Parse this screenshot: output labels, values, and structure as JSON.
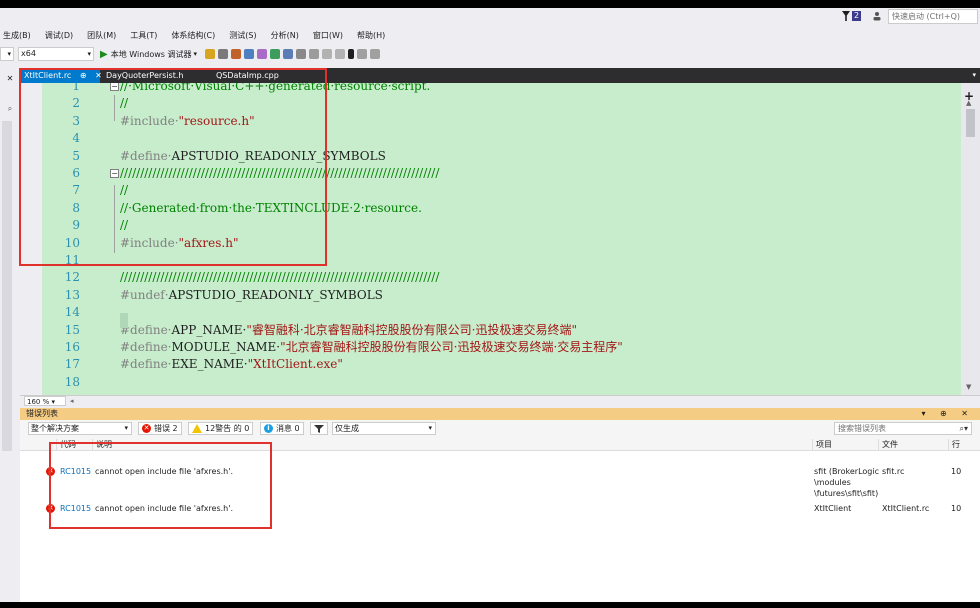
{
  "quick_launch": {
    "placeholder": "快速启动 (Ctrl+Q)",
    "notification_count": "2"
  },
  "menu": [
    "生成(B)",
    "调试(D)",
    "团队(M)",
    "工具(T)",
    "体系结构(C)",
    "测试(S)",
    "分析(N)",
    "窗口(W)",
    "帮助(H)"
  ],
  "toolbar": {
    "platform": "x64",
    "run_label": "本地 Windows 调试器"
  },
  "tabs": [
    {
      "label": "XtItClient.rc",
      "pin": "⊕",
      "close": "✕"
    },
    {
      "label": "DayQuoterPersist.h"
    },
    {
      "label": "QSDataImp.cpp"
    }
  ],
  "editor": {
    "lines": [
      {
        "n": "1",
        "fold": "−",
        "parts": [
          {
            "t": "//·Microsoft·Visual·C++·generated·resource·script.",
            "c": "comment"
          }
        ]
      },
      {
        "n": "2",
        "parts": [
          {
            "t": "//",
            "c": "comment"
          }
        ]
      },
      {
        "n": "3",
        "parts": [
          {
            "t": "#include·",
            "c": "directive"
          },
          {
            "t": "\"resource.h\"",
            "c": "string"
          }
        ]
      },
      {
        "n": "4",
        "parts": []
      },
      {
        "n": "5",
        "parts": [
          {
            "t": "#define·",
            "c": "directive"
          },
          {
            "t": "APSTUDIO_READONLY_SYMBOLS",
            "c": "plain"
          }
        ]
      },
      {
        "n": "6",
        "fold": "−",
        "parts": [
          {
            "t": "///////////////////////////////////////////////////////////////////////////////",
            "c": "comment"
          }
        ]
      },
      {
        "n": "7",
        "parts": [
          {
            "t": "//",
            "c": "comment"
          }
        ]
      },
      {
        "n": "8",
        "parts": [
          {
            "t": "//·Generated·from·the·TEXTINCLUDE·2·resource.",
            "c": "comment"
          }
        ]
      },
      {
        "n": "9",
        "parts": [
          {
            "t": "//",
            "c": "comment"
          }
        ]
      },
      {
        "n": "10",
        "parts": [
          {
            "t": "#include·",
            "c": "directive"
          },
          {
            "t": "\"afxres.h\"",
            "c": "string"
          }
        ]
      },
      {
        "n": "11",
        "parts": []
      },
      {
        "n": "12",
        "parts": [
          {
            "t": "///////////////////////////////////////////////////////////////////////////////",
            "c": "comment"
          }
        ]
      },
      {
        "n": "13",
        "parts": [
          {
            "t": "#undef·",
            "c": "directive"
          },
          {
            "t": "APSTUDIO_READONLY_SYMBOLS",
            "c": "plain"
          }
        ]
      },
      {
        "n": "14",
        "parts": []
      },
      {
        "n": "15",
        "parts": [
          {
            "t": "#define·",
            "c": "directive"
          },
          {
            "t": "APP_NAME·",
            "c": "plain"
          },
          {
            "t": "\"睿智融科·北京睿智融科控股股份有限公司·迅投极速交易终端\"",
            "c": "string"
          }
        ]
      },
      {
        "n": "16",
        "parts": [
          {
            "t": "#define·",
            "c": "directive"
          },
          {
            "t": "MODULE_NAME·",
            "c": "plain"
          },
          {
            "t": "\"北京睿智融科控股股份有限公司·迅投极速交易终端·交易主程序\"",
            "c": "string"
          }
        ]
      },
      {
        "n": "17",
        "parts": [
          {
            "t": "#define·",
            "c": "directive"
          },
          {
            "t": "EXE_NAME·",
            "c": "plain"
          },
          {
            "t": "\"XtItClient.exe\"",
            "c": "string"
          }
        ]
      },
      {
        "n": "18",
        "parts": []
      }
    ],
    "zoom": "160 %"
  },
  "error_list": {
    "title": "错误列表",
    "scope": "整个解决方案",
    "errors_btn": "错误 2",
    "warnings_btn": "12警告 的 0",
    "messages_btn": "消息 0",
    "build_filter": "仅生成",
    "search_placeholder": "搜索错误列表",
    "columns": {
      "code": "代码",
      "desc": "说明",
      "project": "项目",
      "file": "文件",
      "line": "行"
    },
    "rows": [
      {
        "code": "RC1015",
        "desc": "cannot open include file 'afxres.h'.",
        "project": "sfit (BrokerLogic\\modules\\futures\\sfit\\sfit)",
        "project_lines": [
          "sfit (BrokerLogic",
          "\\modules",
          "\\futures\\sfit\\sfit)"
        ],
        "file": "sfit.rc",
        "line": "10"
      },
      {
        "code": "RC1015",
        "desc": "cannot open include file 'afxres.h'.",
        "project": "XtItClient",
        "project_lines": [
          "XtItClient"
        ],
        "file": "XtItClient.rc",
        "line": "10"
      }
    ]
  },
  "colors": {
    "accent": "#007acc",
    "editor_bg": "#c7edcc",
    "error_header": "#f5cc84",
    "highlight": "#e0312c"
  }
}
